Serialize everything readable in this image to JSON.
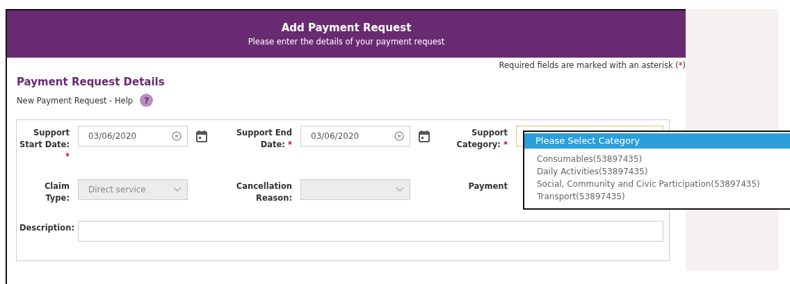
{
  "header": {
    "title": "Add Payment Request",
    "subtitle": "Please enter the details of your payment request"
  },
  "required_note": {
    "before": "Required fields are marked with an asterisk (",
    "mark": "*",
    "after": ")"
  },
  "section": {
    "title": "Payment Request Details",
    "help_link": "New Payment Request - Help",
    "help_icon": "?"
  },
  "fields": [
    {
      "kind": "date",
      "label": "Support Start Date:",
      "required": true,
      "value": "03/06/2020",
      "disabled": false
    },
    {
      "kind": "date",
      "label": "Support End Date:",
      "required": true,
      "value": "03/06/2020",
      "disabled": false
    },
    {
      "kind": "select",
      "label": "Support Category:",
      "required": true,
      "disabled": false,
      "focused": true
    },
    {
      "kind": "select",
      "label": "Claim Type:",
      "required": false,
      "value": "Direct service",
      "disabled": true
    },
    {
      "kind": "select",
      "label": "Cancellation Reason:",
      "required": false,
      "disabled": true
    },
    {
      "kind": "label",
      "label": "Payment",
      "required": false
    },
    {
      "kind": "text",
      "label": "Description:",
      "required": false,
      "disabled": false,
      "wide": true
    }
  ],
  "dropdown": {
    "options": [
      {
        "label": "Please Select Category",
        "selected": true
      },
      {
        "label": "Consumables(53897435)",
        "selected": false
      },
      {
        "label": "Daily Activities(53897435)",
        "selected": false
      },
      {
        "label": "Social, Community and Civic Participation(53897435)",
        "selected": false
      },
      {
        "label": "Transport(53897435)",
        "selected": false
      }
    ]
  }
}
